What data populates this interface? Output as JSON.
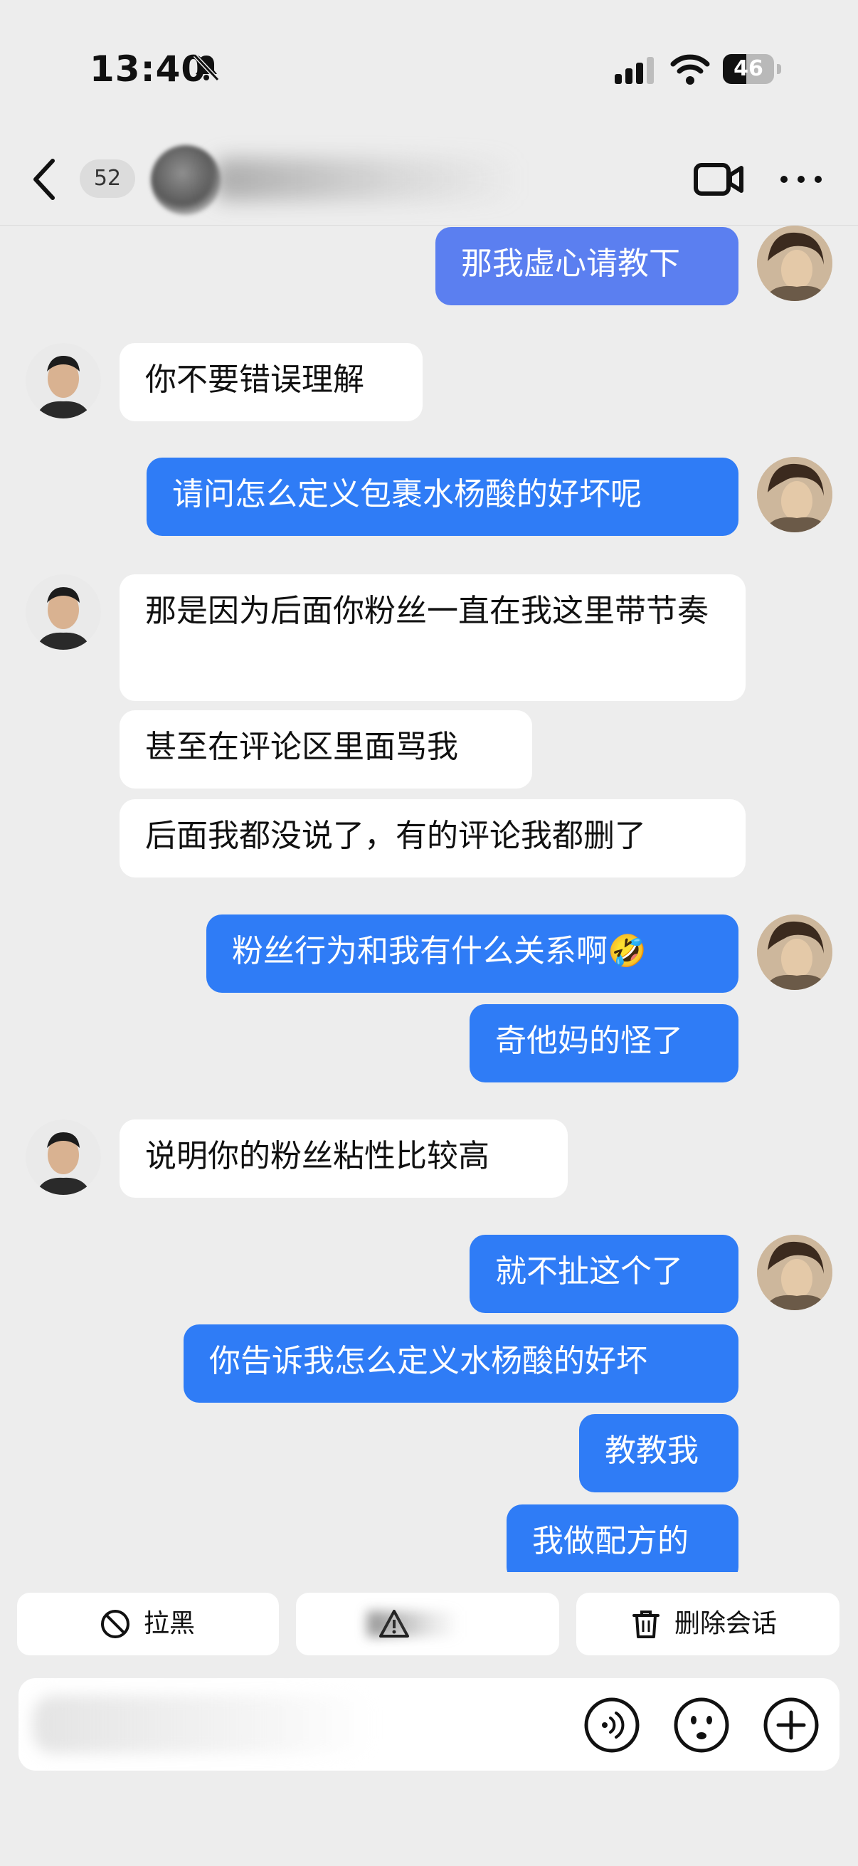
{
  "status_bar": {
    "time": "13:40",
    "battery": "46",
    "battery_level_percent": 46,
    "icons": [
      "bell-muted-icon",
      "cellular-signal-icon",
      "wifi-icon",
      "battery-icon"
    ]
  },
  "nav": {
    "unread_count": "52",
    "icons": [
      "back-chevron-icon",
      "video-call-icon",
      "more-icon"
    ]
  },
  "messages": [
    {
      "side": "out",
      "text": "那我虚心请教下"
    },
    {
      "side": "in",
      "text": "你不要错误理解"
    },
    {
      "side": "out",
      "text": "请问怎么定义包裹水杨酸的好坏呢"
    },
    {
      "side": "in",
      "text": "那是因为后面你粉丝一直在我这里带节奏"
    },
    {
      "side": "in",
      "text": "甚至在评论区里面骂我"
    },
    {
      "side": "in",
      "text": "后面我都没说了，有的评论我都删了"
    },
    {
      "side": "out",
      "text": "粉丝行为和我有什么关系啊",
      "emoji": "🤣"
    },
    {
      "side": "out",
      "text": "奇他妈的怪了"
    },
    {
      "side": "in",
      "text": "说明你的粉丝粘性比较高"
    },
    {
      "side": "out",
      "text": "就不扯这个了"
    },
    {
      "side": "out",
      "text": "你告诉我怎么定义水杨酸的好坏"
    },
    {
      "side": "out",
      "text": "教教我"
    },
    {
      "side": "out",
      "text": "我做配方的"
    }
  ],
  "actions": {
    "block_label": "拉黑",
    "report_label": "",
    "delete_label": "删除会话"
  },
  "input": {
    "placeholder": "",
    "icons": [
      "voice-icon",
      "emoji-icon",
      "plus-icon"
    ]
  },
  "colors": {
    "background": "#ededed",
    "outgoing_bubble": "#2f7cf6",
    "incoming_bubble": "#ffffff"
  }
}
